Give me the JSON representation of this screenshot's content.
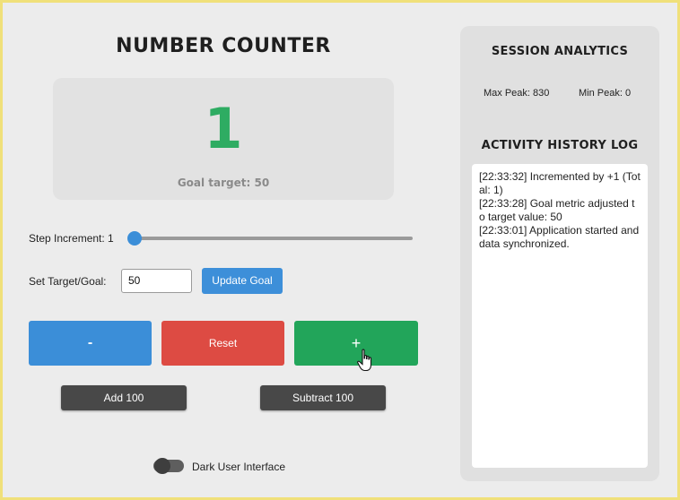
{
  "app": {
    "title": "NUMBER COUNTER"
  },
  "counter": {
    "value": "1",
    "goal_text": "Goal target: 50"
  },
  "step": {
    "label": "Step Increment: 1",
    "value": 1
  },
  "target": {
    "label": "Set Target/Goal:",
    "value": "50",
    "update_label": "Update Goal"
  },
  "buttons": {
    "minus": "-",
    "reset": "Reset",
    "plus": "+",
    "add100": "Add 100",
    "sub100": "Subtract 100"
  },
  "toggle": {
    "label": "Dark User Interface",
    "on": false
  },
  "analytics": {
    "title": "SESSION ANALYTICS",
    "max_peak": "Max Peak: 830",
    "min_peak": "Min Peak: 0"
  },
  "history": {
    "title": "ACTIVITY HISTORY LOG",
    "entries": [
      "[22:33:32] Incremented by +1 (Total: 1)",
      "[22:33:28] Goal metric adjusted to target value: 50",
      "[22:33:01] Application started and data synchronized."
    ]
  },
  "colors": {
    "accent_blue": "#3b8ed8",
    "danger_red": "#dd4b43",
    "success_green": "#22a55a",
    "counter_green": "#2eac62",
    "dark_button": "#484848"
  }
}
